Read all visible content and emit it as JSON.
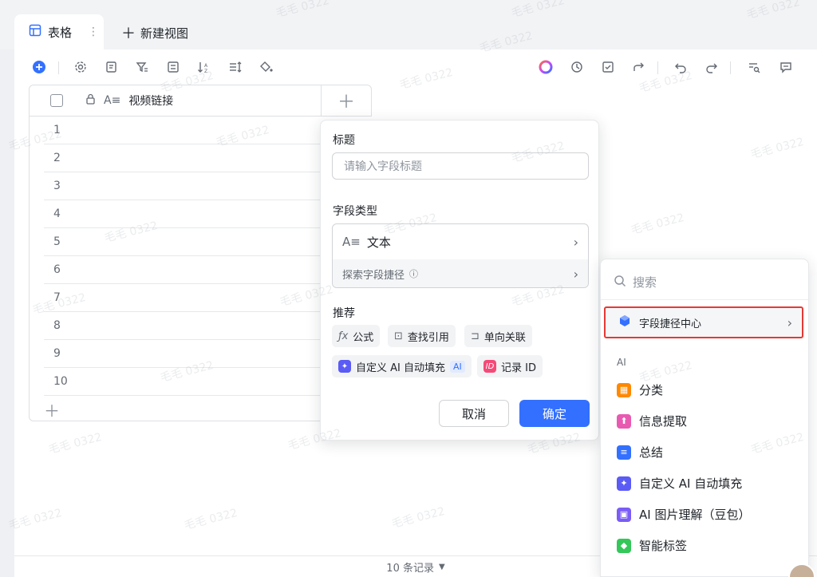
{
  "tabs": {
    "active_label": "表格",
    "new_view_label": "新建视图"
  },
  "grid": {
    "column_title": "视频链接",
    "rows": [
      "1",
      "2",
      "3",
      "4",
      "5",
      "6",
      "7",
      "8",
      "9",
      "10"
    ]
  },
  "footer": {
    "record_count": "10 条记录"
  },
  "popup": {
    "title_label": "标题",
    "title_placeholder": "请输入字段标题",
    "type_label": "字段类型",
    "type_value": "文本",
    "explore_label": "探索字段捷径",
    "recommend_label": "推荐",
    "chips": {
      "formula": "公式",
      "lookup": "查找引用",
      "link": "单向关联",
      "ai_fill": "自定义 AI 自动填充",
      "ai_tag": "AI",
      "record_id": "记录 ID"
    },
    "cancel": "取消",
    "confirm": "确定"
  },
  "panel": {
    "search_placeholder": "搜索",
    "shortcut_center": "字段捷径中心",
    "ai_section": "AI",
    "ai_items": [
      "分类",
      "信息提取",
      "总结",
      "自定义 AI 自动填充",
      "AI 图片理解（豆包）",
      "智能标签"
    ]
  },
  "colors": {
    "accent": "#3370ff",
    "highlight_border": "#e53935"
  },
  "watermark": "毛毛 0322"
}
